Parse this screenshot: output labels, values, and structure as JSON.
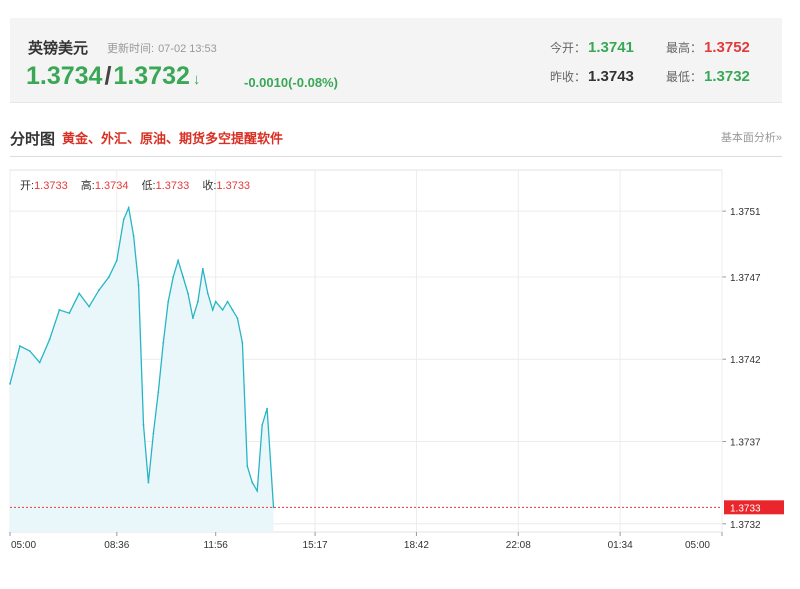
{
  "quote": {
    "name": "英镑美元",
    "updated_label": "更新时间:",
    "updated_time": "07-02 13:53",
    "bid": "1.3734",
    "separator": "/",
    "ask": "1.3732",
    "arrow": "↓",
    "change": "-0.0010(-0.08%)",
    "stats": {
      "open_label": "今开：",
      "open": "1.3741",
      "high_label": "最高：",
      "high": "1.3752",
      "prev_close_label": "昨收：",
      "prev_close": "1.3743",
      "low_label": "最低：",
      "low": "1.3732"
    },
    "colors": {
      "up": "#e03c3c",
      "down": "#3aa757"
    }
  },
  "section": {
    "title": "分时图",
    "promo_link": "黄金、外汇、原油、期货多空提醒软件",
    "right_link": "基本面分析»"
  },
  "ohlc": {
    "open_label": "开:",
    "open": "1.3733",
    "high_label": "高:",
    "high": "1.3734",
    "low_label": "低:",
    "low": "1.3733",
    "close_label": "收:",
    "close": "1.3733"
  },
  "chart_data": {
    "type": "area",
    "x_tick_labels": [
      "05:00",
      "08:36",
      "11:56",
      "15:17",
      "18:42",
      "22:08",
      "01:34",
      "05:00"
    ],
    "y_tick_labels": [
      "1.3751",
      "1.3747",
      "1.3742",
      "1.3737",
      "1.3732"
    ],
    "ylim": [
      1.37315,
      1.37535
    ],
    "current_value": 1.3733,
    "current_label": "1.3733",
    "line_color": "#27b5c5",
    "fill_color": "#eaf7fa",
    "grid": true,
    "x": [
      "05:00",
      "05:20",
      "05:40",
      "06:00",
      "06:20",
      "06:40",
      "07:00",
      "07:20",
      "07:40",
      "08:00",
      "08:20",
      "08:36",
      "08:50",
      "09:00",
      "09:10",
      "09:20",
      "09:30",
      "09:40",
      "09:50",
      "10:00",
      "10:10",
      "10:20",
      "10:30",
      "10:40",
      "10:50",
      "11:00",
      "11:10",
      "11:20",
      "11:30",
      "11:40",
      "11:50",
      "11:56",
      "12:10",
      "12:20",
      "12:30",
      "12:40",
      "12:50",
      "13:00",
      "13:10",
      "13:20",
      "13:30",
      "13:40",
      "13:53"
    ],
    "values": [
      1.37405,
      1.37428,
      1.37425,
      1.37418,
      1.37432,
      1.3745,
      1.37448,
      1.3746,
      1.37452,
      1.37462,
      1.3747,
      1.3748,
      1.37505,
      1.37512,
      1.37495,
      1.37465,
      1.3738,
      1.37345,
      1.37375,
      1.374,
      1.3743,
      1.37455,
      1.3747,
      1.3748,
      1.3747,
      1.3746,
      1.37445,
      1.37455,
      1.37475,
      1.3746,
      1.3745,
      1.37455,
      1.3745,
      1.37455,
      1.3745,
      1.37445,
      1.3743,
      1.37355,
      1.37345,
      1.3734,
      1.3738,
      1.3739,
      1.3733
    ]
  }
}
